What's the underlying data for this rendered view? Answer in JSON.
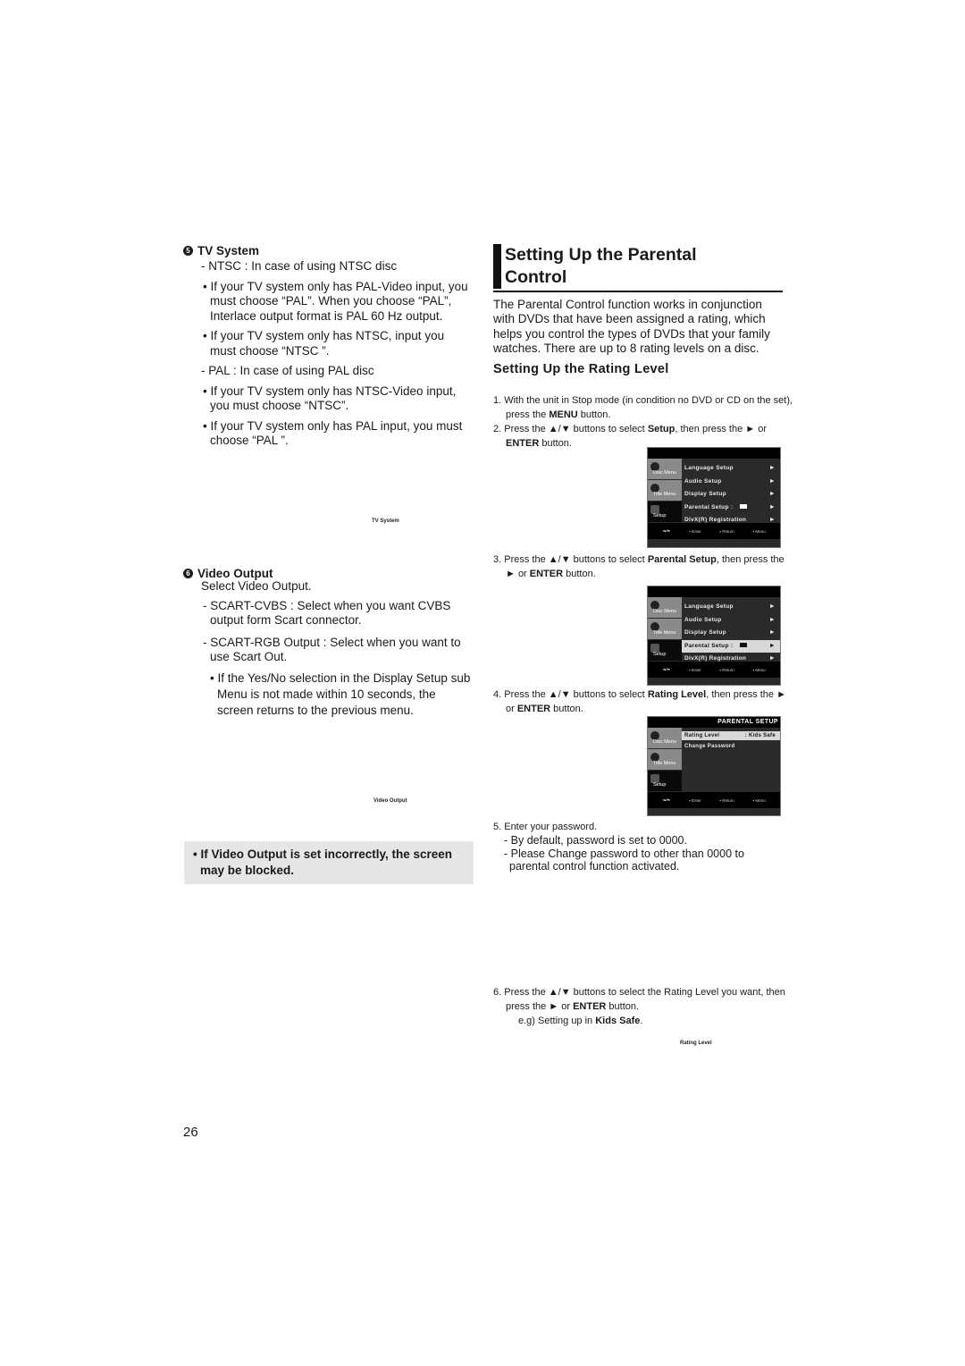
{
  "left": {
    "tv_system": {
      "number": "5",
      "heading": "TV System",
      "items": [
        {
          "type": "dash",
          "text": "- NTSC : In case of using NTSC disc"
        },
        {
          "type": "bullet",
          "text": "• If your TV system only has PAL-Video input, you must choose “PAL”. When you choose “PAL”, Interlace output format is PAL 60 Hz output."
        },
        {
          "type": "bullet",
          "text": "• If your TV system only has NTSC, input you must choose “NTSC ”."
        },
        {
          "type": "dash",
          "text": "- PAL : In case of using PAL disc"
        },
        {
          "type": "bullet",
          "text": "• If your TV system only has NTSC-Video input, you must choose “NTSC”."
        },
        {
          "type": "bullet",
          "text": "• If your TV system only has PAL input, you must choose “PAL ”."
        }
      ],
      "caption": "TV System"
    },
    "video_output": {
      "number": "6",
      "heading": "Video Output",
      "intro": "Select Video Output.",
      "items": [
        {
          "type": "dash",
          "text": "- SCART-CVBS : Select when you want CVBS output form Scart connector."
        },
        {
          "type": "dash",
          "text": "- SCART-RGB Output : Select when you want to use Scart Out."
        },
        {
          "type": "bullet",
          "text": "• If the Yes/No selection in the Display Setup sub Menu is not made within 10 seconds, the screen returns to the previous menu."
        }
      ],
      "caption": "Video Output"
    },
    "note": "• If Video Output is set incorrectly, the screen may be blocked."
  },
  "right": {
    "title_line1": "Setting Up the Parental",
    "title_line2": "Control",
    "intro": "The Parental Control function works in conjunction with DVDs that have been assigned a rating, which helps you control the types of DVDs that your family watches. There are up to 8 rating levels on a disc.",
    "subtitle": "Setting Up the Rating Level",
    "steps": {
      "s1": {
        "pre": "1. With the unit in Stop mode (in condition no DVD or CD on the set), press the ",
        "bold": "MENU",
        "post": " button."
      },
      "s2": {
        "pre": "2. Press the ▲/▼ buttons to select ",
        "bold": "Setup",
        "mid": ", then press the ► or ",
        "bold2": "ENTER",
        "post": " button."
      },
      "s3": {
        "pre": "3. Press the ▲/▼ buttons to select ",
        "bold": "Parental Setup",
        "mid": ", then press the ► or ",
        "bold2": "ENTER",
        "post": " button."
      },
      "s4": {
        "pre": "4. Press the ▲/▼ buttons to select ",
        "bold": "Rating Level",
        "mid": ", then press the ► or ",
        "bold2": "ENTER",
        "post": " button."
      },
      "s5": {
        "text": "5. Enter your password.",
        "sub": [
          "- By default, password is set to 0000.",
          "- Please Change password to other than 0000 to parental control function activated."
        ]
      },
      "s6": {
        "pre": "6. Press the ▲/▼ buttons to select the Rating Level you want, then press the ► or ",
        "bold": "ENTER",
        "mid": " button.",
        "line2_pre": "e.g) Setting up in ",
        "line2_bold": "Kids Safe",
        "line2_post": "."
      }
    },
    "caption_rating": "Rating Level"
  },
  "osd": {
    "tabs": [
      "Disc Menu",
      "Title Menu",
      "Setup"
    ],
    "setup_items": [
      "Language Setup",
      "Audio Setup",
      "Display Setup",
      "Parental Setup :",
      "DivX(R) Registration"
    ],
    "parental_title": "PARENTAL SETUP",
    "parental_items": [
      {
        "label": "Rating Level",
        "value": ": Kids Safe"
      },
      {
        "label": "Change Password",
        "value": ""
      }
    ],
    "footer": {
      "nav": "◂▴▾▸",
      "enter": "Enter",
      "return": "Return",
      "menu": "Menu"
    },
    "arrow": "►"
  },
  "page_number": "26"
}
